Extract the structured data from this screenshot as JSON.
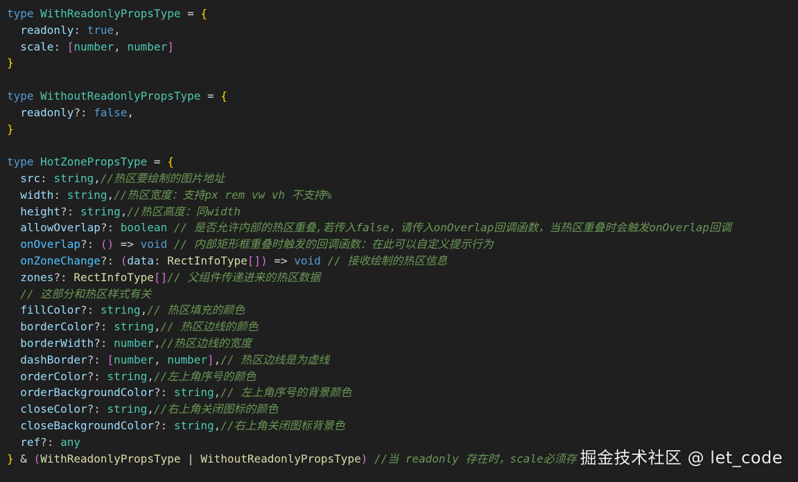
{
  "code": {
    "lines": [
      [
        [
          "kw",
          "type "
        ],
        [
          "type",
          "WithReadonlyPropsType"
        ],
        [
          "op",
          " = "
        ],
        [
          "brace",
          "{"
        ]
      ],
      [
        [
          "plain",
          "  "
        ],
        [
          "prop",
          "readonly"
        ],
        [
          "punc",
          ": "
        ],
        [
          "bool",
          "true"
        ],
        [
          "punc",
          ","
        ]
      ],
      [
        [
          "plain",
          "  "
        ],
        [
          "prop",
          "scale"
        ],
        [
          "punc",
          ": "
        ],
        [
          "bracket",
          "["
        ],
        [
          "type",
          "number"
        ],
        [
          "punc",
          ", "
        ],
        [
          "type",
          "number"
        ],
        [
          "bracket",
          "]"
        ]
      ],
      [
        [
          "brace",
          "}"
        ]
      ],
      [],
      [
        [
          "kw",
          "type "
        ],
        [
          "type",
          "WithoutReadonlyPropsType"
        ],
        [
          "op",
          " = "
        ],
        [
          "brace",
          "{"
        ]
      ],
      [
        [
          "plain",
          "  "
        ],
        [
          "prop",
          "readonly"
        ],
        [
          "punc",
          "?: "
        ],
        [
          "bool",
          "false"
        ],
        [
          "punc",
          ","
        ]
      ],
      [
        [
          "brace",
          "}"
        ]
      ],
      [],
      [
        [
          "kw",
          "type "
        ],
        [
          "type",
          "HotZonePropsType"
        ],
        [
          "op",
          " = "
        ],
        [
          "brace",
          "{"
        ]
      ],
      [
        [
          "plain",
          "  "
        ],
        [
          "prop",
          "src"
        ],
        [
          "punc",
          ": "
        ],
        [
          "type",
          "string"
        ],
        [
          "punc",
          ","
        ],
        [
          "comment",
          "//热区要绘制的图片地址"
        ]
      ],
      [
        [
          "plain",
          "  "
        ],
        [
          "prop",
          "width"
        ],
        [
          "punc",
          ": "
        ],
        [
          "type",
          "string"
        ],
        [
          "punc",
          ","
        ],
        [
          "comment",
          "//热区宽度：支持px rem vw vh 不支持%"
        ]
      ],
      [
        [
          "plain",
          "  "
        ],
        [
          "prop",
          "height"
        ],
        [
          "punc",
          "?: "
        ],
        [
          "type",
          "string"
        ],
        [
          "punc",
          ","
        ],
        [
          "comment",
          "//热区高度：同width"
        ]
      ],
      [
        [
          "plain",
          "  "
        ],
        [
          "prop",
          "allowOverlap"
        ],
        [
          "punc",
          "?: "
        ],
        [
          "type",
          "boolean"
        ],
        [
          "comment",
          " // 是否允许内部的热区重叠,若传入false，请传入onOverlap回调函数，当热区重叠时会触发onOverlap回调"
        ]
      ],
      [
        [
          "plain",
          "  "
        ],
        [
          "fn",
          "onOverlap"
        ],
        [
          "punc",
          "?: "
        ],
        [
          "paren",
          "()"
        ],
        [
          "op",
          " => "
        ],
        [
          "kw",
          "void"
        ],
        [
          "comment",
          " // 内部矩形框重叠时触发的回调函数：在此可以自定义提示行为"
        ]
      ],
      [
        [
          "plain",
          "  "
        ],
        [
          "fn",
          "onZoneChange"
        ],
        [
          "punc",
          "?: "
        ],
        [
          "paren",
          "("
        ],
        [
          "prop",
          "data"
        ],
        [
          "punc",
          ": "
        ],
        [
          "ytype",
          "RectInfoType"
        ],
        [
          "bracket",
          "[]"
        ],
        [
          "paren",
          ")"
        ],
        [
          "op",
          " => "
        ],
        [
          "kw",
          "void"
        ],
        [
          "comment",
          " // 接收绘制的热区信息"
        ]
      ],
      [
        [
          "plain",
          "  "
        ],
        [
          "prop",
          "zones"
        ],
        [
          "punc",
          "?: "
        ],
        [
          "ytype",
          "RectInfoType"
        ],
        [
          "bracket",
          "[]"
        ],
        [
          "comment",
          "// 父组件传递进来的热区数据"
        ]
      ],
      [
        [
          "plain",
          "  "
        ],
        [
          "comment",
          "// 这部分和热区样式有关"
        ]
      ],
      [
        [
          "plain",
          "  "
        ],
        [
          "prop",
          "fillColor"
        ],
        [
          "punc",
          "?: "
        ],
        [
          "type",
          "string"
        ],
        [
          "punc",
          ","
        ],
        [
          "comment",
          "// 热区填充的颜色"
        ]
      ],
      [
        [
          "plain",
          "  "
        ],
        [
          "prop",
          "borderColor"
        ],
        [
          "punc",
          "?: "
        ],
        [
          "type",
          "string"
        ],
        [
          "punc",
          ","
        ],
        [
          "comment",
          "// 热区边线的颜色"
        ]
      ],
      [
        [
          "plain",
          "  "
        ],
        [
          "prop",
          "borderWidth"
        ],
        [
          "punc",
          "?: "
        ],
        [
          "type",
          "number"
        ],
        [
          "punc",
          ","
        ],
        [
          "comment",
          "//热区边线的宽度"
        ]
      ],
      [
        [
          "plain",
          "  "
        ],
        [
          "prop",
          "dashBorder"
        ],
        [
          "punc",
          "?: "
        ],
        [
          "bracket",
          "["
        ],
        [
          "type",
          "number"
        ],
        [
          "punc",
          ", "
        ],
        [
          "type",
          "number"
        ],
        [
          "bracket",
          "]"
        ],
        [
          "punc",
          ","
        ],
        [
          "comment",
          "// 热区边线是为虚线"
        ]
      ],
      [
        [
          "plain",
          "  "
        ],
        [
          "prop",
          "orderColor"
        ],
        [
          "punc",
          "?: "
        ],
        [
          "type",
          "string"
        ],
        [
          "punc",
          ","
        ],
        [
          "comment",
          "//左上角序号的颜色"
        ]
      ],
      [
        [
          "plain",
          "  "
        ],
        [
          "prop",
          "orderBackgroundColor"
        ],
        [
          "punc",
          "?: "
        ],
        [
          "type",
          "string"
        ],
        [
          "punc",
          ","
        ],
        [
          "comment",
          "// 左上角序号的背景颜色"
        ]
      ],
      [
        [
          "plain",
          "  "
        ],
        [
          "prop",
          "closeColor"
        ],
        [
          "punc",
          "?: "
        ],
        [
          "type",
          "string"
        ],
        [
          "punc",
          ","
        ],
        [
          "comment",
          "//右上角关闭图标的颜色"
        ]
      ],
      [
        [
          "plain",
          "  "
        ],
        [
          "prop",
          "closeBackgroundColor"
        ],
        [
          "punc",
          "?: "
        ],
        [
          "type",
          "string"
        ],
        [
          "punc",
          ","
        ],
        [
          "comment",
          "//右上角关闭图标背景色"
        ]
      ],
      [
        [
          "plain",
          "  "
        ],
        [
          "prop",
          "ref"
        ],
        [
          "punc",
          "?: "
        ],
        [
          "type",
          "any"
        ]
      ],
      [
        [
          "brace",
          "}"
        ],
        [
          "op",
          " & "
        ],
        [
          "paren",
          "("
        ],
        [
          "ytype",
          "WithReadonlyPropsType"
        ],
        [
          "op",
          " | "
        ],
        [
          "ytype",
          "WithoutReadonlyPropsType"
        ],
        [
          "paren",
          ")"
        ],
        [
          "comment",
          " //当 readonly 存在时，scale必须存"
        ]
      ]
    ]
  },
  "watermark": {
    "text": "掘金技术社区 @ let_code"
  },
  "colors": {
    "background": "#1f1f1f",
    "keyword": "#569cd6",
    "type": "#4ec9b0",
    "property": "#9cdcfe",
    "function_property": "#4fc1ff",
    "brace": "#ffd700",
    "bracket": "#da70d6",
    "user_type": "#dcdcaa",
    "comment": "#6a9955"
  }
}
